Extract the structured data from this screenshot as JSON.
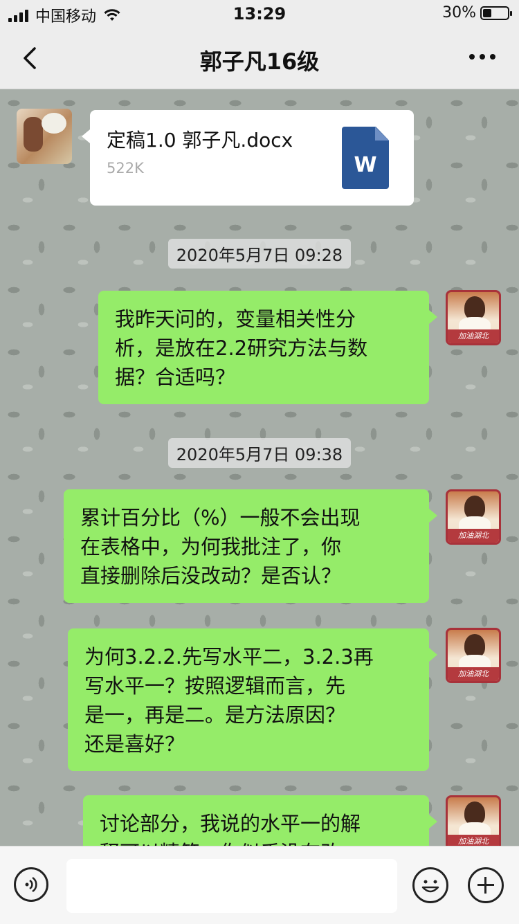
{
  "status_bar": {
    "carrier": "中国移动",
    "time": "13:29",
    "battery": "30%"
  },
  "nav": {
    "title": "郭子凡16级"
  },
  "file_message": {
    "filename": "定稿1.0 郭子凡.docx",
    "size": "522K",
    "icon_letter": "W"
  },
  "timestamps": [
    "2020年5月7日 09:28",
    "2020年5月7日 09:38"
  ],
  "messages": [
    {
      "lines": [
        "我昨天问的，变量相关性分",
        "析，是放在2.2研究方法与数",
        "据？合适吗？"
      ]
    },
    {
      "lines": [
        "累计百分比（%）一般不会出现",
        "在表格中，为何我批注了，你",
        "直接删除后没改动？是否认？"
      ]
    },
    {
      "lines": [
        "为何3.2.2.先写水平二，3.2.3再",
        "写水平一？按照逻辑而言，先",
        "是一，再是二。是方法原因？",
        "还是喜好？"
      ]
    },
    {
      "lines": [
        "讨论部分，我说的水平一的解",
        "释可以精简，你似乎没有改"
      ]
    }
  ],
  "avatar_right_caption": "加油湖北",
  "input": {
    "placeholder": ""
  }
}
